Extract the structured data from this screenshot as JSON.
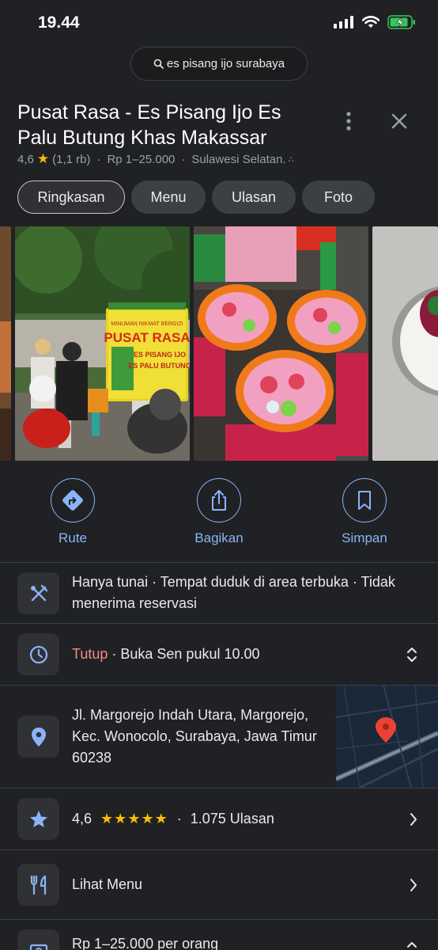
{
  "status": {
    "time": "19.44"
  },
  "search": {
    "query": "es pisang ijo surabaya"
  },
  "place": {
    "title": "Pusat Rasa - Es Pisang Ijo Es Palu Butung Khas Makassar",
    "rating": "4,6",
    "reviews_short": "(1,1 rb)",
    "price": "Rp 1–25.000",
    "category": "Sulawesi Selatan.",
    "dot": "·"
  },
  "tabs": [
    {
      "label": "Ringkasan"
    },
    {
      "label": "Menu"
    },
    {
      "label": "Ulasan"
    },
    {
      "label": "Foto"
    }
  ],
  "photos": {
    "sign_top": "MINUMAN NIKMAT BERGIZI",
    "sign_main": "PUSAT RASA",
    "sign_sub1": "ES PISANG IJO",
    "sign_sub2": "ES PALU BUTUNG"
  },
  "actions": [
    {
      "label": "Rute",
      "icon": "directions-icon"
    },
    {
      "label": "Bagikan",
      "icon": "share-icon"
    },
    {
      "label": "Simpan",
      "icon": "bookmark-icon"
    }
  ],
  "info": {
    "amenities": "Hanya tunai · Tempat duduk di area terbuka · Tidak menerima reservasi",
    "hours_status": "Tutup",
    "hours_detail": " · Buka Sen pukul 10.00",
    "address": "Jl. Margorejo Indah Utara, Margorejo, Kec. Wonocolo, Surabaya, Jawa Timur 60238",
    "rating": "4,6",
    "stars": "★★★★★",
    "reviews": "1.075 Ulasan",
    "menu": "Lihat Menu",
    "price_per_person": "Rp 1–25.000 per orang"
  },
  "colors": {
    "accent": "#8ab4f8",
    "star": "#fbbc04",
    "closed": "#f28b82",
    "background": "#202124"
  }
}
